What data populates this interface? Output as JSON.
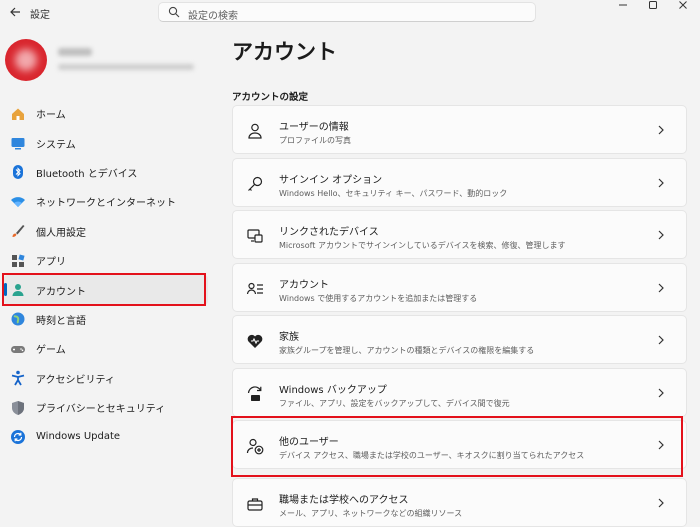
{
  "window": {
    "title": "設定",
    "back_icon": "arrow-left-icon",
    "controls": [
      "minimize",
      "maximize",
      "close"
    ]
  },
  "search": {
    "placeholder": "設定の検索"
  },
  "sidebar": {
    "items": [
      {
        "label": "ホーム",
        "icon": "home-icon"
      },
      {
        "label": "システム",
        "icon": "monitor-icon"
      },
      {
        "label": "Bluetooth とデバイス",
        "icon": "bluetooth-icon"
      },
      {
        "label": "ネットワークとインターネット",
        "icon": "wifi-icon"
      },
      {
        "label": "個人用設定",
        "icon": "brush-icon"
      },
      {
        "label": "アプリ",
        "icon": "apps-icon"
      },
      {
        "label": "アカウント",
        "icon": "person-icon",
        "active": true
      },
      {
        "label": "時刻と言語",
        "icon": "globe-icon"
      },
      {
        "label": "ゲーム",
        "icon": "gamepad-icon"
      },
      {
        "label": "アクセシビリティ",
        "icon": "accessibility-icon"
      },
      {
        "label": "プライバシーとセキュリティ",
        "icon": "shield-icon"
      },
      {
        "label": "Windows Update",
        "icon": "update-icon"
      }
    ]
  },
  "main": {
    "title": "アカウント",
    "section_title": "アカウントの設定",
    "cards": [
      {
        "title": "ユーザーの情報",
        "subtitle": "プロファイルの写真",
        "icon": "user-info-icon"
      },
      {
        "title": "サインイン オプション",
        "subtitle": "Windows Hello、セキュリティ キー、パスワード、動的ロック",
        "icon": "key-icon"
      },
      {
        "title": "リンクされたデバイス",
        "subtitle": "Microsoft アカウントでサインインしているデバイスを検索、修復、管理します",
        "icon": "linked-devices-icon"
      },
      {
        "title": "アカウント",
        "subtitle": "Windows で使用するアカウントを追加または管理する",
        "icon": "accounts-list-icon"
      },
      {
        "title": "家族",
        "subtitle": "家族グループを管理し、アカウントの種類とデバイスの権限を編集する",
        "icon": "family-heart-icon"
      },
      {
        "title": "Windows バックアップ",
        "subtitle": "ファイル、アプリ、設定をバックアップして、デバイス間で復元",
        "icon": "backup-icon"
      },
      {
        "title": "他のユーザー",
        "subtitle": "デバイス アクセス、職場または学校のユーザー、キオスクに割り当てられたアクセス",
        "icon": "add-user-icon"
      },
      {
        "title": "職場または学校へのアクセス",
        "subtitle": "メール、アプリ、ネットワークなどの組織リソース",
        "icon": "briefcase-icon"
      }
    ]
  },
  "colors": {
    "accent": "#0067c0",
    "highlight": "#e3111b",
    "background": "#f3f3f3",
    "card": "#fbfbfb"
  }
}
